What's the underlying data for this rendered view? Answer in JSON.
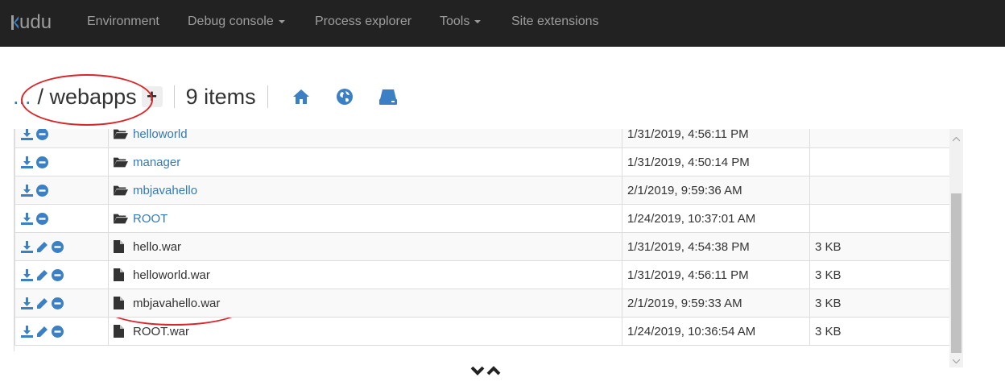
{
  "app": {
    "brand": "Kudu",
    "brand_rest": "udu"
  },
  "nav": {
    "items": [
      {
        "label": "Environment"
      },
      {
        "label": "Debug console",
        "dropdown": true
      },
      {
        "label": "Process explorer"
      },
      {
        "label": "Tools",
        "dropdown": true
      },
      {
        "label": "Site extensions"
      }
    ]
  },
  "path": {
    "dots": "...",
    "name": "/ webapps",
    "add_label": "+"
  },
  "item_count": "9 items",
  "toolbar_icons": [
    "home-icon",
    "globe-icon",
    "drive-icon"
  ],
  "files": [
    {
      "name": "helloworld",
      "type": "dir",
      "modified": "1/31/2019, 4:56:11 PM",
      "size": ""
    },
    {
      "name": "manager",
      "type": "dir",
      "modified": "1/31/2019, 4:50:14 PM",
      "size": ""
    },
    {
      "name": "mbjavahello",
      "type": "dir",
      "modified": "2/1/2019, 9:59:36 AM",
      "size": ""
    },
    {
      "name": "ROOT",
      "type": "dir",
      "modified": "1/24/2019, 10:37:01 AM",
      "size": ""
    },
    {
      "name": "hello.war",
      "type": "file",
      "modified": "1/31/2019, 4:54:38 PM",
      "size": "3 KB"
    },
    {
      "name": "helloworld.war",
      "type": "file",
      "modified": "1/31/2019, 4:56:11 PM",
      "size": "3 KB"
    },
    {
      "name": "mbjavahello.war",
      "type": "file",
      "modified": "2/1/2019, 9:59:33 AM",
      "size": "3 KB"
    },
    {
      "name": "ROOT.war",
      "type": "file",
      "modified": "1/24/2019, 10:36:54 AM",
      "size": "3 KB"
    }
  ],
  "colors": {
    "navbar": "#222222",
    "link": "#337ab7",
    "highlight": "#d9262a",
    "icon_blue": "#3b7fc4"
  }
}
